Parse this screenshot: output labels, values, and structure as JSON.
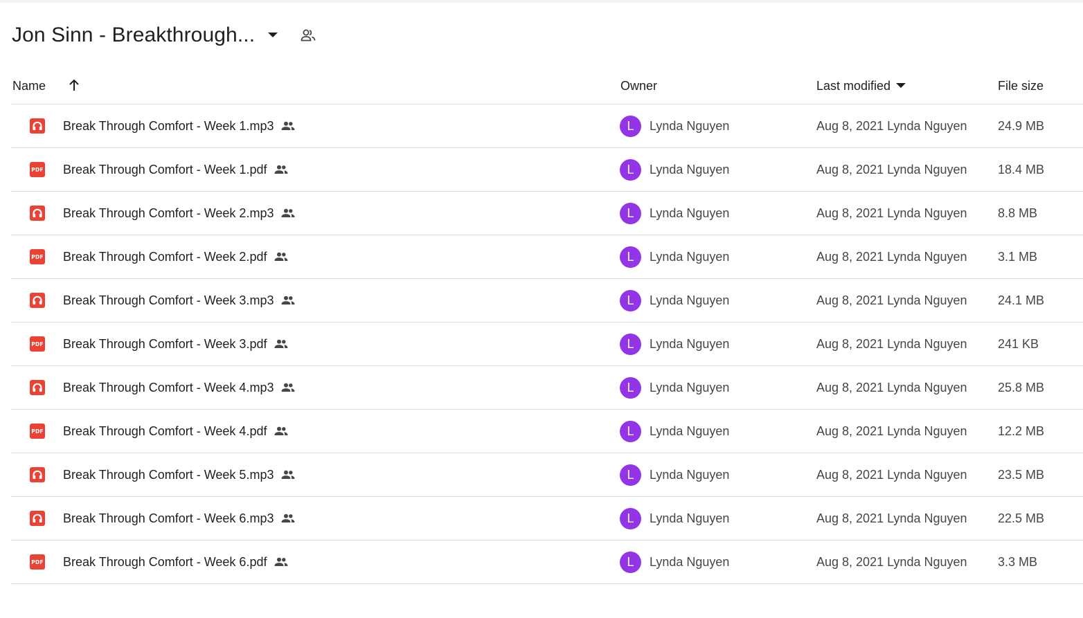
{
  "header": {
    "title": "Jon Sinn - Breakthrough...",
    "title_menu_icon": "caret-down-icon",
    "shared_icon": "people-outline-icon"
  },
  "columns": {
    "name": "Name",
    "owner": "Owner",
    "last_modified": "Last modified",
    "file_size": "File size",
    "name_sort_icon": "arrow-up-icon",
    "modified_sort_icon": "caret-down-icon"
  },
  "colors": {
    "file_icon_red": "#ea4335",
    "avatar_purple": "#9334e6",
    "divider": "#dadce0"
  },
  "files": [
    {
      "name": "Break Through Comfort - Week 1.mp3",
      "type": "audio",
      "icon": "headphones-icon",
      "owner_initial": "L",
      "owner": "Lynda Nguyen",
      "modified": "Aug 8, 2021 Lynda Nguyen",
      "size": "24.9 MB"
    },
    {
      "name": "Break Through Comfort - Week 1.pdf",
      "type": "pdf",
      "icon": "pdf-icon",
      "icon_text": "PDF",
      "owner_initial": "L",
      "owner": "Lynda Nguyen",
      "modified": "Aug 8, 2021 Lynda Nguyen",
      "size": "18.4 MB"
    },
    {
      "name": "Break Through Comfort - Week 2.mp3",
      "type": "audio",
      "icon": "headphones-icon",
      "owner_initial": "L",
      "owner": "Lynda Nguyen",
      "modified": "Aug 8, 2021 Lynda Nguyen",
      "size": "8.8 MB"
    },
    {
      "name": "Break Through Comfort - Week 2.pdf",
      "type": "pdf",
      "icon": "pdf-icon",
      "icon_text": "PDF",
      "owner_initial": "L",
      "owner": "Lynda Nguyen",
      "modified": "Aug 8, 2021 Lynda Nguyen",
      "size": "3.1 MB"
    },
    {
      "name": "Break Through Comfort - Week 3.mp3",
      "type": "audio",
      "icon": "headphones-icon",
      "owner_initial": "L",
      "owner": "Lynda Nguyen",
      "modified": "Aug 8, 2021 Lynda Nguyen",
      "size": "24.1 MB"
    },
    {
      "name": "Break Through Comfort - Week 3.pdf",
      "type": "pdf",
      "icon": "pdf-icon",
      "icon_text": "PDF",
      "owner_initial": "L",
      "owner": "Lynda Nguyen",
      "modified": "Aug 8, 2021 Lynda Nguyen",
      "size": "241 KB"
    },
    {
      "name": "Break Through Comfort - Week 4.mp3",
      "type": "audio",
      "icon": "headphones-icon",
      "owner_initial": "L",
      "owner": "Lynda Nguyen",
      "modified": "Aug 8, 2021 Lynda Nguyen",
      "size": "25.8 MB"
    },
    {
      "name": "Break Through Comfort - Week 4.pdf",
      "type": "pdf",
      "icon": "pdf-icon",
      "icon_text": "PDF",
      "owner_initial": "L",
      "owner": "Lynda Nguyen",
      "modified": "Aug 8, 2021 Lynda Nguyen",
      "size": "12.2 MB"
    },
    {
      "name": "Break Through Comfort - Week 5.mp3",
      "type": "audio",
      "icon": "headphones-icon",
      "owner_initial": "L",
      "owner": "Lynda Nguyen",
      "modified": "Aug 8, 2021 Lynda Nguyen",
      "size": "23.5 MB"
    },
    {
      "name": "Break Through Comfort - Week 6.mp3",
      "type": "audio",
      "icon": "headphones-icon",
      "owner_initial": "L",
      "owner": "Lynda Nguyen",
      "modified": "Aug 8, 2021 Lynda Nguyen",
      "size": "22.5 MB"
    },
    {
      "name": "Break Through Comfort - Week 6.pdf",
      "type": "pdf",
      "icon": "pdf-icon",
      "icon_text": "PDF",
      "owner_initial": "L",
      "owner": "Lynda Nguyen",
      "modified": "Aug 8, 2021 Lynda Nguyen",
      "size": "3.3 MB"
    }
  ]
}
